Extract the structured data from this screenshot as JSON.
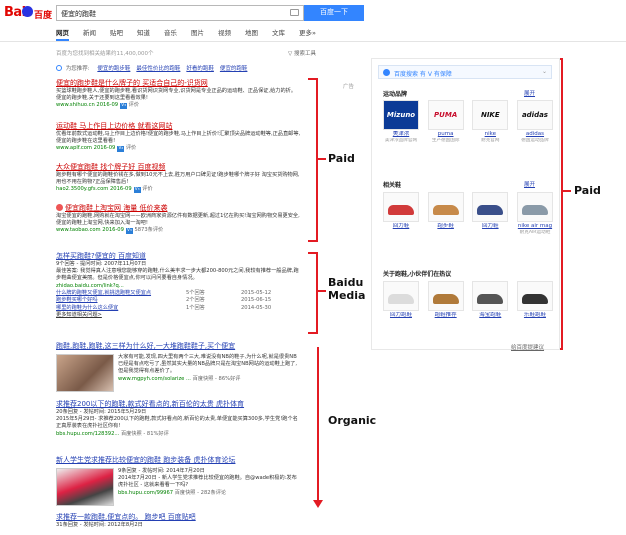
{
  "header": {
    "logo_text_1": "Bai",
    "logo_text_2": "百度",
    "query": "便宜的跑鞋",
    "search_button": "百度一下"
  },
  "tabs": [
    {
      "label": "网页",
      "active": true
    },
    {
      "label": "新闻"
    },
    {
      "label": "贴吧"
    },
    {
      "label": "知道"
    },
    {
      "label": "音乐"
    },
    {
      "label": "图片"
    },
    {
      "label": "视频"
    },
    {
      "label": "地图"
    },
    {
      "label": "文库"
    },
    {
      "label": "更多»"
    }
  ],
  "result_count": "百度为您找到相关结果约11,400,000个",
  "search_tools": "搜索工具",
  "recommend": {
    "prefix": "为您推荐:",
    "links": [
      "便宜的跑步鞋",
      "最佳性价比的跑鞋",
      "好看的跑鞋",
      "便宜的跑鞋"
    ]
  },
  "ad_label": "广告",
  "ads": [
    {
      "title": "便宜的跑步鞋是什么牌子的 买适合自己的-识货网",
      "desc": "买篮球鞋跑步鞋人,便宜的跑步鞋,看识货网识货网专业,识货网是专业正品的运动鞋、正品保证,给力的折。便宜的跑步鞋,关于还要到这里看看效果!",
      "url": "www.shihuo.cn  2016-09",
      "extra": "评价"
    },
    {
      "title": "运动鞋 马上作目上边价格 就看这网站",
      "desc": "优看年前款式运动鞋,马上作目上边价格!便宜的跑步鞋,马上作目上折价!汇聚顶尖品牌运动鞋等,正品直邮等,便宜的跑步鞋在这里看看!",
      "url": "www.aplf.com  2016-09",
      "extra": "评价"
    },
    {
      "title": "大众便宜跑鞋 找个牌子好 百度视频",
      "desc": "跑步鞋有哪个便宜的跑鞋价钱在多,做到10元不上去,胜万用户口碑见证!跑步鞋哪个牌子好 淘宝买货购物网,用也不用在购物?正品保障售后!",
      "url": "hao2.3500y.gfs.com  2016-09",
      "extra": "评价"
    },
    {
      "title": "便宜跑鞋上淘宝网 海量 低价来袭",
      "desc": "淘宝便宜的跑鞋,网购就在淘宝网——欧洲商家资源亿件有数据更新,超过1亿在购买!淘宝网购物交易更安全,便宜的跑鞋上淘宝网,快来加入淘一淘吧!",
      "url": "www.taobao.com  2016-09",
      "extra": "5873条评价"
    }
  ],
  "zhidao": {
    "title": "怎样买跑鞋?便宜的 百度知道",
    "meta": "9个回答 - 提问时间: 2007年11月07日",
    "desc": "最佳答案: 我觉得真人注意哦您能够穿的跑鞋,什么美丰求一步大都200-800元之间,我较有推荐一般品牌,跑步鞋曲便宜美丽。但是价格便宜点,你可以问问要看自身情况。",
    "url": "zhidao.baidu.com/link?q...",
    "rows": [
      {
        "q": "什么牌的跑鞋又便宜,就挑选跑鞋又便宜点",
        "n": "5个回答",
        "d": "2015-05-12"
      },
      {
        "q": "跑步鞋买哪个好吗",
        "n": "2个回答",
        "d": "2015-06-15"
      },
      {
        "q": "哪里的跑鞋为什么这么便宜",
        "n": "1个回答",
        "d": "2014-05-30"
      }
    ],
    "more": "更多知道相关问题>"
  },
  "organic": [
    {
      "title": "跑鞋,跑鞋,跑鞋,这三样为什么好,一大堆跑鞋鞋子,买个便宜",
      "desc": "大家有可能,发现,四大里有两个三大,难说没有NB的鞋子,为什么呢,就是很贵NB已经是有点吃亏了,虽然其实大量的NB品牌只是在淘宝NB网站的运动鞋上跑了,但是我觉得有点差价了。",
      "url": "www.mgpyh.com/solarize ...",
      "extra": "百度快照 - 86%好评"
    },
    {
      "title": "求推荐200以下的跑鞋,款式好看点的,新百伦的太贵 虎扑体育",
      "meta": "20条回复 - 发帖时间: 2015年5月29日",
      "desc": "2015年5月29日- 求推荐200以下的跑鞋,款式好看点的,新百伦的太贵,单便宜能买算300多,学生党!跑个名正真厚装表在虎扑社区你有!",
      "url": "bbs.hupu.com/128392...",
      "extra": "百度快照 - 81%好评"
    },
    {
      "title": "新人学生党求推荐比较便宜的跑鞋 跑步装备 虎扑体育论坛",
      "meta": "9条回复 - 发帖时间: 2014年7月20日",
      "desc": "2014年7月20日 - 新人学生党求推荐比较便宜的跑鞋。自@wade积极的:发布虎扑社区 - 这就来看看一下吗?",
      "url": "bbs.hupu.com/99967",
      "extra": "百度快照 - 282条评论"
    },
    {
      "title": "求推荐一款跑鞋,便宜点的。 跑步吧 百度贴吧",
      "meta": "31条回复 - 发帖时间: 2012年8月2日",
      "desc": "",
      "url": "",
      "extra": ""
    }
  ],
  "panel": {
    "search_text": "百度搜索 有 V 有保障",
    "sections": [
      {
        "title": "运动品牌",
        "more": "展开",
        "items": [
          {
            "name": "美津浓",
            "sub": "美津浓品牌官网",
            "logo": "Mizuno",
            "color": "#0b3a96"
          },
          {
            "name": "puma",
            "sub": "生产德国国际",
            "logo": "PUMA",
            "color": "#c8102e"
          },
          {
            "name": "nike",
            "sub": "耐克官网",
            "logo": "NIKE",
            "color": "#111111"
          },
          {
            "name": "adidas",
            "sub": "德国运动品牌",
            "logo": "adidas",
            "color": "#111111"
          }
        ]
      },
      {
        "title": "相关鞋",
        "more": "展开",
        "items": [
          {
            "name": "回力鞋",
            "sub": "",
            "color": "#d13a3a"
          },
          {
            "name": "跑步鞋",
            "sub": "",
            "color": "#c78a4a"
          },
          {
            "name": "回力鞋",
            "sub": "",
            "color": "#3a4f8a"
          },
          {
            "name": "nike air mag",
            "sub": "耐克AIR运动鞋",
            "color": "#8a9aa8"
          }
        ]
      },
      {
        "title": "关于跑鞋,小伙伴们在热议",
        "more": "",
        "items": [
          {
            "name": "回力跑鞋",
            "sub": "",
            "color": "#dcdcdc"
          },
          {
            "name": "跑鞋推荐",
            "sub": "",
            "color": "#b07a3a"
          },
          {
            "name": "海宝跑鞋",
            "sub": "",
            "color": "#555555"
          },
          {
            "name": "乐鞋跑鞋",
            "sub": "",
            "color": "#333333"
          }
        ]
      }
    ],
    "feedback": "给百度提建议"
  },
  "annotations": {
    "paid_main": "Paid",
    "baidu_media": "Baidu\nMedia",
    "organic": "Organic",
    "paid_side": "Paid"
  },
  "colors": {
    "accent": "#3385ff",
    "bracket": "#e31b23",
    "ad_title": "#cc0000",
    "link": "#2440b3",
    "url": "#008000"
  }
}
